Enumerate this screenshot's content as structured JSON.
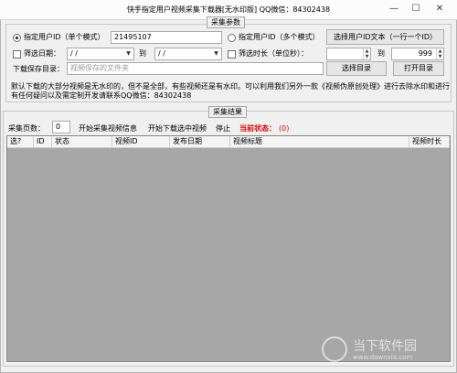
{
  "window": {
    "title": "快手指定用户视频采集下载器[无水印版] QQ微信：84302438",
    "minimize_glyph": "—",
    "maximize_glyph": "☐",
    "close_glyph": "✕"
  },
  "params": {
    "legend": "采集参数",
    "single_user_label": "指定用户ID（单个模式）",
    "user_id_value": "21495107",
    "multi_user_label": "指定用户ID（多个模式）",
    "choose_file_button": "选择用户ID文本（一行一个ID）",
    "date_filter_label": "筛选日期：",
    "date_from_value": "  /  /",
    "date_to_label": "到",
    "date_to_value": "  /  /",
    "duration_filter_label": "筛选时长（单位秒）：",
    "duration_from_value": "",
    "duration_to_label": "到",
    "duration_to_value": "999",
    "save_dir_label": "下载保存目录：",
    "save_dir_placeholder": "视频保存的文件夹",
    "choose_dir_button": "选择目录",
    "open_dir_button": "打开目录",
    "notice_line1": "默认下载的大部分视频是无水印的，但不是全部，有些视频还是有水印。可以利用我们另外一款《视频伪原创处理》进行去除水印和进行",
    "notice_line2": "有任何疑问以及需定制开发请联系QQ微信：84302438"
  },
  "results": {
    "legend": "采集结果",
    "pages_label": "采集页数：",
    "pages_value": "0",
    "start_collect": "开始采集视频信息",
    "start_download": "开始下载选中视频",
    "stop": "停止",
    "status_label": "当前状态：",
    "status_value": "(0)",
    "status_color": "#e00000",
    "columns": [
      "选?",
      "ID",
      "状态",
      "视频ID",
      "发布日期",
      "视频标题",
      "视频时长"
    ]
  },
  "watermark": {
    "site_name": "当下软件园",
    "site_url": "www.downxia.com"
  }
}
